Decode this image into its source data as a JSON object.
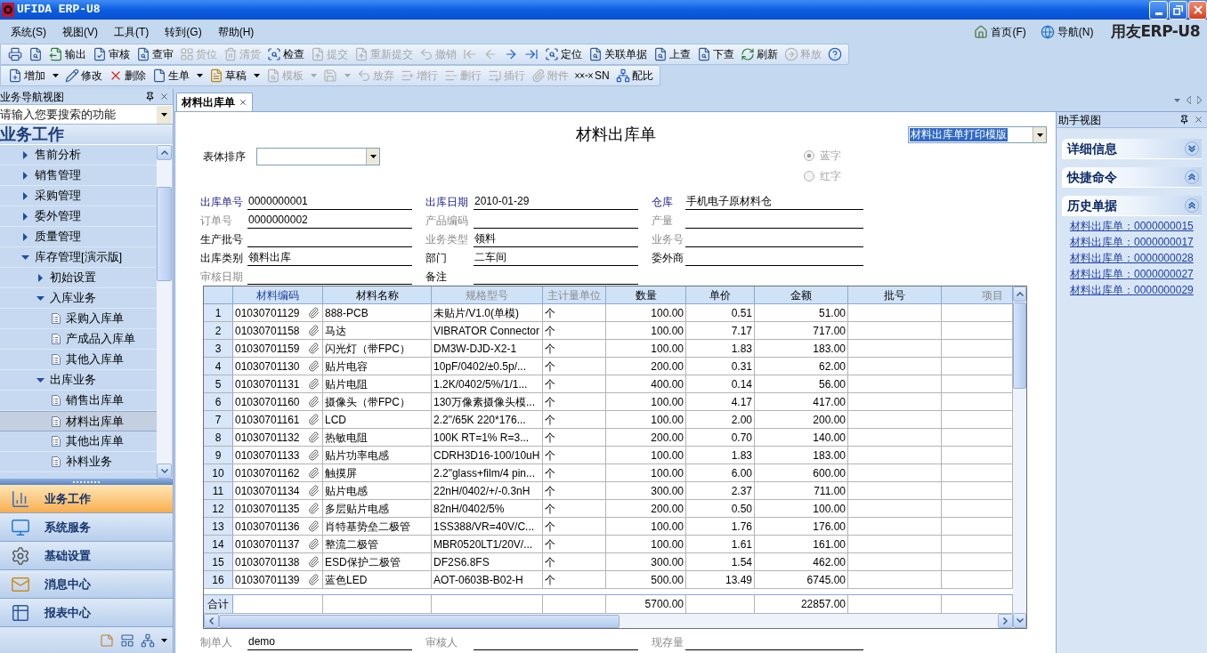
{
  "window": {
    "title": "UFIDA ERP-U8"
  },
  "menu_bar": {
    "menus": [
      "系统(S)",
      "视图(V)",
      "工具(T)",
      "转到(G)",
      "帮助(H)"
    ],
    "links": [
      "首页(F)",
      "导航(N)"
    ],
    "logo": "用友ERP-U8"
  },
  "toolbar_1": [
    {
      "disabled": false
    },
    {
      "disabled": false
    },
    {
      "label": "输出",
      "disabled": false
    },
    {
      "label": "审核",
      "disabled": false
    },
    {
      "label": "查审",
      "disabled": false
    },
    {
      "label": "货位",
      "disabled": true
    },
    {
      "label": "清货",
      "disabled": true
    },
    {
      "label": "检查",
      "disabled": false
    },
    {
      "label": "提交",
      "disabled": true
    },
    {
      "label": "重新提交",
      "disabled": true
    },
    {
      "label": "撤销",
      "disabled": true
    },
    {
      "disabled": true
    },
    {
      "disabled": true
    },
    {
      "disabled": false
    },
    {
      "disabled": false
    },
    {
      "label": "定位",
      "disabled": false
    },
    {
      "label": "关联单据",
      "disabled": false
    },
    {
      "label": "上查",
      "disabled": false
    },
    {
      "label": "下查",
      "disabled": false
    },
    {
      "label": "刷新",
      "disabled": false
    },
    {
      "label": "释放",
      "disabled": true
    },
    {
      "disabled": false
    }
  ],
  "toolbar_2": [
    {
      "label": "增加",
      "disabled": false,
      "has_menu": true
    },
    {
      "label": "修改",
      "disabled": false,
      "has_menu": false
    },
    {
      "label": "删除",
      "disabled": false,
      "has_menu": false
    },
    {
      "label": "生单",
      "disabled": false,
      "has_menu": true
    },
    {
      "label": "草稿",
      "disabled": false,
      "has_menu": true
    },
    {
      "label": "模板",
      "disabled": true,
      "has_menu": true
    },
    {
      "disabled": true,
      "has_menu": true
    },
    {
      "label": "放弃",
      "disabled": true,
      "has_menu": false
    },
    {
      "label": "增行",
      "disabled": true,
      "has_menu": false
    },
    {
      "label": "删行",
      "disabled": true,
      "has_menu": false
    },
    {
      "label": "插行",
      "disabled": true,
      "has_menu": false
    },
    {
      "label": "附件",
      "disabled": true,
      "has_menu": false
    },
    {
      "label": "SN",
      "disabled": false,
      "has_menu": false
    },
    {
      "label": "配比",
      "disabled": false,
      "has_menu": false
    }
  ],
  "nav_panel": {
    "title": "业务导航视图",
    "search": {
      "placeholder": "请输入您要搜索的功能"
    },
    "heading": "业务工作",
    "tree": [
      {
        "label": "售前分析",
        "kind": "group",
        "expanded": false,
        "selected": false
      },
      {
        "label": "销售管理",
        "kind": "group",
        "expanded": false,
        "selected": false
      },
      {
        "label": "采购管理",
        "kind": "group",
        "expanded": false,
        "selected": false
      },
      {
        "label": "委外管理",
        "kind": "group",
        "expanded": false,
        "selected": false
      },
      {
        "label": "质量管理",
        "kind": "group",
        "expanded": false,
        "selected": false
      },
      {
        "label": "库存管理[演示版]",
        "kind": "group",
        "expanded": true,
        "selected": false,
        "children": [
          {
            "label": "初始设置",
            "kind": "group",
            "expanded": false,
            "selected": false
          },
          {
            "label": "入库业务",
            "kind": "group",
            "expanded": true,
            "selected": false,
            "children": [
              {
                "label": "采购入库单",
                "kind": "form",
                "selected": false
              },
              {
                "label": "产成品入库单",
                "kind": "form",
                "selected": false
              },
              {
                "label": "其他入库单",
                "kind": "form",
                "selected": false
              }
            ]
          },
          {
            "label": "出库业务",
            "kind": "group",
            "expanded": true,
            "selected": false,
            "children": [
              {
                "label": "销售出库单",
                "kind": "form",
                "selected": false
              },
              {
                "label": "材料出库单",
                "kind": "form",
                "selected": true
              },
              {
                "label": "其他出库单",
                "kind": "form",
                "selected": false
              },
              {
                "label": "补料业务",
                "kind": "form",
                "selected": false
              }
            ]
          }
        ]
      }
    ],
    "modules": [
      {
        "label": "业务工作",
        "selected": true
      },
      {
        "label": "系统服务",
        "selected": false
      },
      {
        "label": "基础设置",
        "selected": false
      },
      {
        "label": "消息中心",
        "selected": false
      },
      {
        "label": "报表中心",
        "selected": false
      }
    ]
  },
  "document_tabs": [
    {
      "label": "材料出库单",
      "selected": true
    }
  ],
  "document": {
    "title": "材料出库单",
    "print_template": "材料出库单打印模版",
    "sort": {
      "label": "表体排序"
    },
    "ink": [
      {
        "label": "蓝字",
        "selected": true,
        "disabled": true
      },
      {
        "label": "红字",
        "selected": false,
        "disabled": true
      }
    ],
    "fields": [
      {
        "label": "出库单号",
        "value": "0000000001",
        "kind": "required"
      },
      {
        "label": "出库日期",
        "value": "2010-01-29",
        "kind": "required"
      },
      {
        "label": "仓库",
        "value": "手机电子原材料仓",
        "kind": "required"
      },
      {
        "label": "订单号",
        "value": "0000000002",
        "kind": "readonly"
      },
      {
        "label": "产品编码",
        "kind": "readonly"
      },
      {
        "label": "产量",
        "kind": "readonly"
      },
      {
        "label": "生产批号",
        "kind": "editable"
      },
      {
        "label": "业务类型",
        "value": "领料",
        "kind": "readonly"
      },
      {
        "label": "业务号",
        "kind": "readonly"
      },
      {
        "label": "出库类别",
        "value": "领料出库",
        "kind": "editable"
      },
      {
        "label": "部门",
        "value": "二车间",
        "kind": "editable"
      },
      {
        "label": "委外商",
        "kind": "editable"
      },
      {
        "label": "审核日期",
        "kind": "readonly"
      },
      {
        "label": "备注",
        "kind": "editable"
      }
    ],
    "table": {
      "columns": [
        {
          "label": "材料编码",
          "kind": "required"
        },
        {
          "label": "材料名称",
          "kind": "editable"
        },
        {
          "label": "规格型号",
          "kind": "readonly"
        },
        {
          "label": "主计量单位",
          "kind": "readonly"
        },
        {
          "label": "数量",
          "kind": "editable"
        },
        {
          "label": "单价",
          "kind": "editable"
        },
        {
          "label": "金额",
          "kind": "editable"
        },
        {
          "label": "批号",
          "kind": "editable"
        },
        {
          "label": "项目",
          "kind": "readonly"
        }
      ],
      "rows": [
        {
          "no": "1",
          "cells": [
            "01030701129",
            "888-PCB",
            "未贴片/V1.0(单模)",
            "个",
            "100.00",
            "0.51",
            "51.00"
          ]
        },
        {
          "no": "2",
          "cells": [
            "01030701158",
            "马达",
            "VIBRATOR Connector",
            "个",
            "100.00",
            "7.17",
            "717.00"
          ]
        },
        {
          "no": "3",
          "cells": [
            "01030701159",
            "闪光灯（带FPC）",
            "DM3W-DJD-X2-1",
            "个",
            "100.00",
            "1.83",
            "183.00"
          ]
        },
        {
          "no": "4",
          "cells": [
            "01030701130",
            "贴片电容",
            "10pF/0402/±0.5p/...",
            "个",
            "200.00",
            "0.31",
            "62.00"
          ]
        },
        {
          "no": "5",
          "cells": [
            "01030701131",
            "贴片电阻",
            "1.2K/0402/5%/1/1...",
            "个",
            "400.00",
            "0.14",
            "56.00"
          ]
        },
        {
          "no": "6",
          "cells": [
            "01030701160",
            "摄像头（带FPC）",
            "130万像素摄像头模...",
            "个",
            "100.00",
            "4.17",
            "417.00"
          ]
        },
        {
          "no": "7",
          "cells": [
            "01030701161",
            "LCD",
            "2.2\"/65K 220*176...",
            "个",
            "100.00",
            "2.00",
            "200.00"
          ]
        },
        {
          "no": "8",
          "cells": [
            "01030701132",
            "热敏电阻",
            "100K RT=1% R=3...",
            "个",
            "200.00",
            "0.70",
            "140.00"
          ]
        },
        {
          "no": "9",
          "cells": [
            "01030701133",
            "贴片功率电感",
            "CDRH3D16-100/10uH",
            "个",
            "100.00",
            "1.83",
            "183.00"
          ]
        },
        {
          "no": "10",
          "cells": [
            "01030701162",
            "触摸屏",
            "2.2\"glass+film/4 pin...",
            "个",
            "100.00",
            "6.00",
            "600.00"
          ]
        },
        {
          "no": "11",
          "cells": [
            "01030701134",
            "贴片电感",
            "22nH/0402/+/-0.3nH",
            "个",
            "300.00",
            "2.37",
            "711.00"
          ]
        },
        {
          "no": "12",
          "cells": [
            "01030701135",
            "多层贴片电感",
            "82nH/0402/5%",
            "个",
            "200.00",
            "0.50",
            "100.00"
          ]
        },
        {
          "no": "13",
          "cells": [
            "01030701136",
            "肖特基势垒二极管",
            "1SS388/VR=40V/C...",
            "个",
            "100.00",
            "1.76",
            "176.00"
          ]
        },
        {
          "no": "14",
          "cells": [
            "01030701137",
            "整流二极管",
            "MBR0520LT1/20V/...",
            "个",
            "100.00",
            "1.61",
            "161.00"
          ]
        },
        {
          "no": "15",
          "cells": [
            "01030701138",
            "ESD保护二极管",
            "DF2S6.8FS",
            "个",
            "300.00",
            "1.54",
            "462.00"
          ]
        },
        {
          "no": "16",
          "cells": [
            "01030701139",
            "蓝色LED",
            "AOT-0603B-B02-H",
            "个",
            "500.00",
            "13.49",
            "6745.00"
          ]
        }
      ],
      "totals": {
        "label": "合计",
        "quantity": "5700.00",
        "amount": "22857.00"
      }
    },
    "footer": [
      {
        "label": "制单人",
        "value": "demo",
        "kind": "readonly"
      },
      {
        "label": "审核人",
        "kind": "readonly"
      },
      {
        "label": "现存量",
        "kind": "readonly"
      }
    ]
  },
  "assistant": {
    "title": "助手视图",
    "sections": [
      {
        "title": "详细信息",
        "expanded": false
      },
      {
        "title": "快捷命令",
        "expanded": true
      },
      {
        "title": "历史单据",
        "expanded": true,
        "links": [
          "材料出库单：0000000015",
          "材料出库单：0000000017",
          "材料出库单：0000000028",
          "材料出库单：0000000027",
          "材料出库单：0000000029"
        ]
      }
    ]
  }
}
